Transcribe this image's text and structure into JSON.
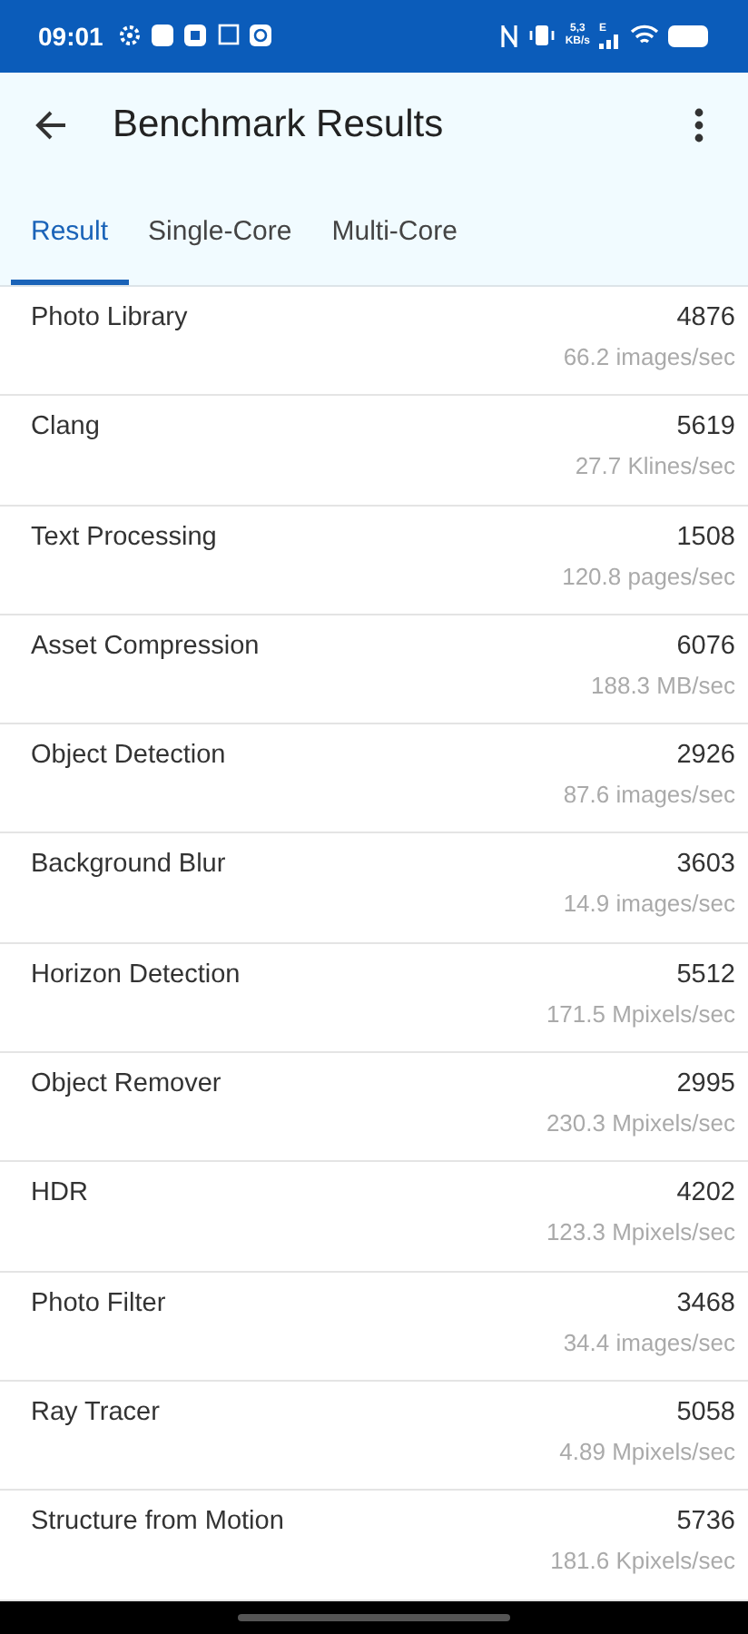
{
  "status_bar": {
    "time": "09:01",
    "net_speed": "5,3",
    "net_unit": "KB/s",
    "network_type": "E"
  },
  "app_bar": {
    "title": "Benchmark Results"
  },
  "tabs": [
    {
      "label": "Result",
      "selected": true
    },
    {
      "label": "Single-Core",
      "selected": false
    },
    {
      "label": "Multi-Core",
      "selected": false
    }
  ],
  "results": [
    {
      "name": "Photo Library",
      "score": "4876",
      "rate": "66.2 images/sec"
    },
    {
      "name": "Clang",
      "score": "5619",
      "rate": "27.7 Klines/sec"
    },
    {
      "name": "Text Processing",
      "score": "1508",
      "rate": "120.8 pages/sec"
    },
    {
      "name": "Asset Compression",
      "score": "6076",
      "rate": "188.3 MB/sec"
    },
    {
      "name": "Object Detection",
      "score": "2926",
      "rate": "87.6 images/sec"
    },
    {
      "name": "Background Blur",
      "score": "3603",
      "rate": "14.9 images/sec"
    },
    {
      "name": "Horizon Detection",
      "score": "5512",
      "rate": "171.5 Mpixels/sec"
    },
    {
      "name": "Object Remover",
      "score": "2995",
      "rate": "230.3 Mpixels/sec"
    },
    {
      "name": "HDR",
      "score": "4202",
      "rate": "123.3 Mpixels/sec"
    },
    {
      "name": "Photo Filter",
      "score": "3468",
      "rate": "34.4 images/sec"
    },
    {
      "name": "Ray Tracer",
      "score": "5058",
      "rate": "4.89 Mpixels/sec"
    },
    {
      "name": "Structure from Motion",
      "score": "5736",
      "rate": "181.6 Kpixels/sec"
    }
  ]
}
